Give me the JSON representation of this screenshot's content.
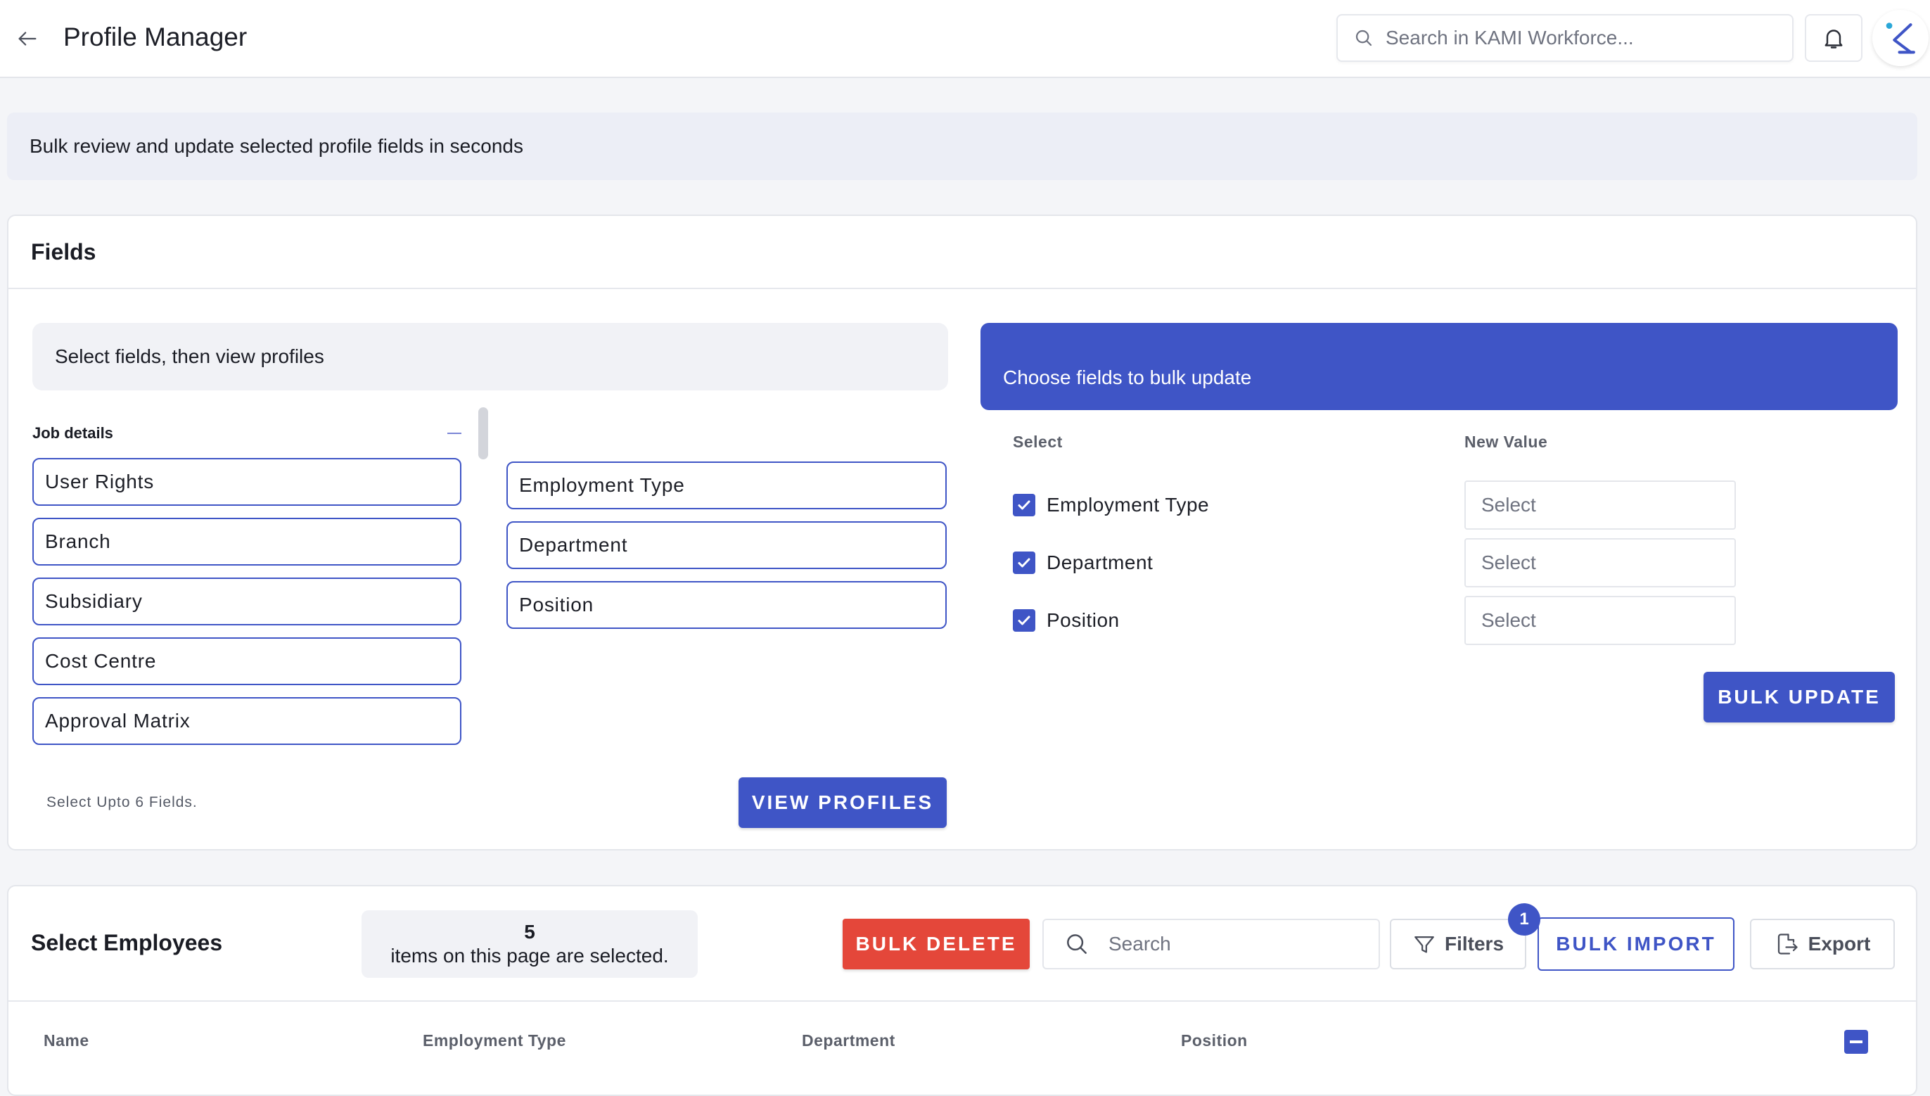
{
  "header": {
    "title": "Profile Manager",
    "search_placeholder": "Search in KAMI Workforce..."
  },
  "banner": {
    "text": "Bulk review and update selected profile fields in seconds"
  },
  "fields_panel": {
    "title": "Fields",
    "info_text": "Select fields, then view profiles",
    "group_title": "Job details",
    "available_fields": [
      "User Rights",
      "Branch",
      "Subsidiary",
      "Cost Centre",
      "Approval Matrix"
    ],
    "selected_fields": [
      "Employment Type",
      "Department",
      "Position"
    ],
    "hint": "Select Upto 6 Fields.",
    "view_profiles_label": "VIEW PROFILES"
  },
  "bulk_update": {
    "header": "Choose fields to bulk update",
    "col_select": "Select",
    "col_new_value": "New Value",
    "rows": [
      {
        "label": "Employment Type",
        "checked": true,
        "value_placeholder": "Select"
      },
      {
        "label": "Department",
        "checked": true,
        "value_placeholder": "Select"
      },
      {
        "label": "Position",
        "checked": true,
        "value_placeholder": "Select"
      }
    ],
    "button_label": "BULK UPDATE"
  },
  "employees": {
    "title": "Select Employees",
    "selected_count": "5",
    "selected_text": "items on this page are selected.",
    "bulk_delete_label": "BULK DELETE",
    "search_placeholder": "Search",
    "filters_label": "Filters",
    "filter_badge": "1",
    "bulk_import_label": "BULK IMPORT",
    "export_label": "Export",
    "columns": [
      "Name",
      "Employment Type",
      "Department",
      "Position"
    ]
  },
  "colors": {
    "primary": "#3f55c6",
    "danger": "#e4473a",
    "banner_bg": "#eceef6"
  },
  "icons": {
    "back": "arrow-left-icon",
    "search": "search-icon",
    "notifications": "bell-icon",
    "logo": "kami-logo-icon",
    "filter": "funnel-icon",
    "export": "export-icon",
    "check": "checkmark-icon"
  }
}
